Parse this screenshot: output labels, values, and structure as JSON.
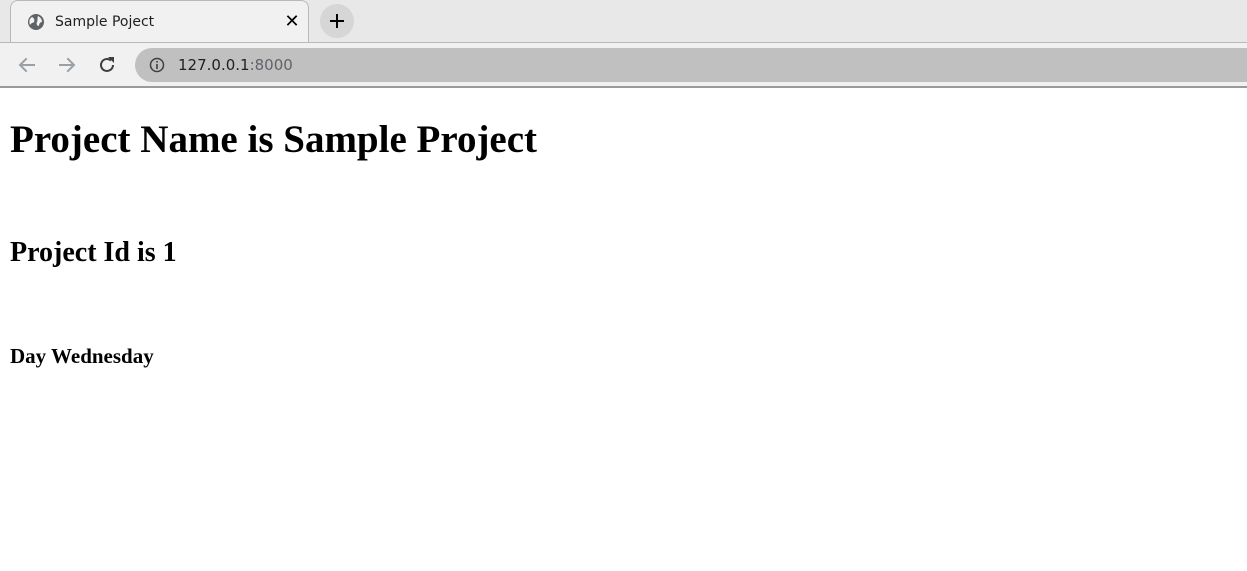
{
  "browser": {
    "tab": {
      "title": "Sample Poject",
      "close_glyph": "✕",
      "favicon": "globe-icon"
    },
    "new_tab_icon": "plus-icon",
    "nav": {
      "back_icon": "arrow-left-icon",
      "forward_icon": "arrow-right-icon",
      "reload_icon": "reload-icon"
    },
    "address": {
      "info_icon": "info-icon",
      "host": "127.0.0.1",
      "port": ":8000"
    }
  },
  "page": {
    "heading1": "Project Name is Sample Project",
    "heading2": "Project Id is 1",
    "heading3": "Day Wednesday"
  }
}
